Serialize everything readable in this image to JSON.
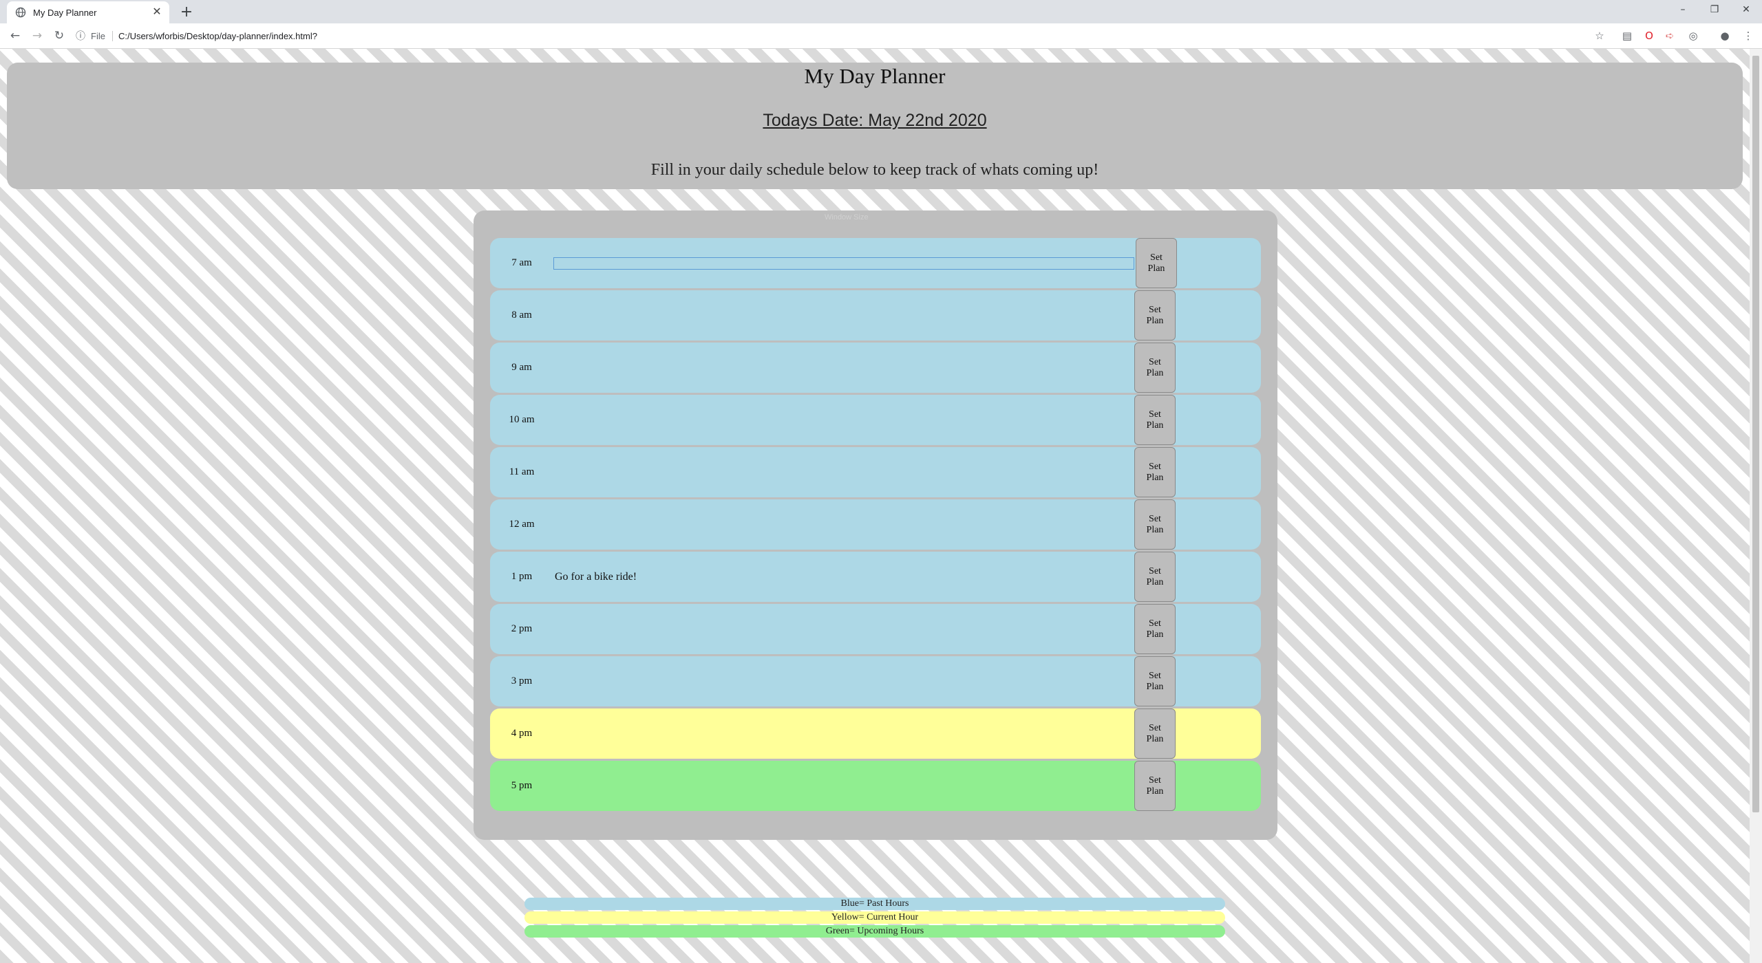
{
  "browser": {
    "tab_title": "My Day Planner",
    "tab_close": "✕",
    "new_tab": "+",
    "url_chip": "File",
    "url": "C:/Users/wforbis/Desktop/day-planner/index.html?",
    "window_minimize": "–",
    "window_restore": "❐",
    "window_close": "✕"
  },
  "header": {
    "title": "My Day Planner",
    "date": "Todays Date: May 22nd 2020",
    "subtitle": "Fill in your daily schedule below to keep track of whats coming up!"
  },
  "card": {
    "watermark": "Window Size"
  },
  "rows": [
    {
      "hour": "7 am",
      "plan": "",
      "state": "past",
      "focused": true
    },
    {
      "hour": "8 am",
      "plan": "",
      "state": "past"
    },
    {
      "hour": "9 am",
      "plan": "",
      "state": "past"
    },
    {
      "hour": "10 am",
      "plan": "",
      "state": "past"
    },
    {
      "hour": "11 am",
      "plan": "",
      "state": "past"
    },
    {
      "hour": "12 am",
      "plan": "",
      "state": "past"
    },
    {
      "hour": "1 pm",
      "plan": "Go for a bike ride!",
      "state": "past"
    },
    {
      "hour": "2 pm",
      "plan": "",
      "state": "past"
    },
    {
      "hour": "3 pm",
      "plan": "",
      "state": "past"
    },
    {
      "hour": "4 pm",
      "plan": "",
      "state": "present"
    },
    {
      "hour": "5 pm",
      "plan": "",
      "state": "future"
    }
  ],
  "button_label": "Set Plan",
  "legend": {
    "blue": "Blue= Past Hours",
    "yellow": "Yellow= Current Hour",
    "green": "Green= Upcoming Hours"
  },
  "colors": {
    "past": "#add8e6",
    "present": "#ffff99",
    "future": "#90ee90",
    "header_bg": "#bfbfbf"
  }
}
